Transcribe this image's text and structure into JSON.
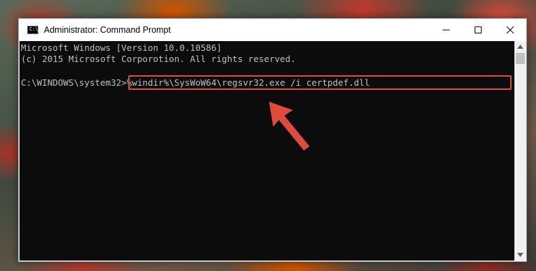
{
  "window": {
    "title": "Administrator: Command Prompt",
    "app_icon_text": "C:\\",
    "controls": [
      "minimize-icon",
      "maximize-icon",
      "close-icon"
    ]
  },
  "console": {
    "lines": [
      "Microsoft Windows [Version 10.0.10586]",
      "(c) 2015 Microsoft Corporotion. All rights reserved.",
      "",
      "C:\\WINDOWS\\system32>%windir%\\SysWoW64\\regsvr32.exe /i certpdef.dll"
    ],
    "prompt": "C:\\WINDOWS\\system32>",
    "command": "%windir%\\SysWoW64\\regsvr32.exe /i certpdef.dll"
  },
  "annotation": {
    "highlight_color": "#e04b3a",
    "arrow_color": "#e04b3a",
    "arrow_icon": "arrow-pointing-up-left"
  },
  "scrollbar": {
    "up_icon": "scroll-up-icon",
    "down_icon": "scroll-down-icon"
  }
}
